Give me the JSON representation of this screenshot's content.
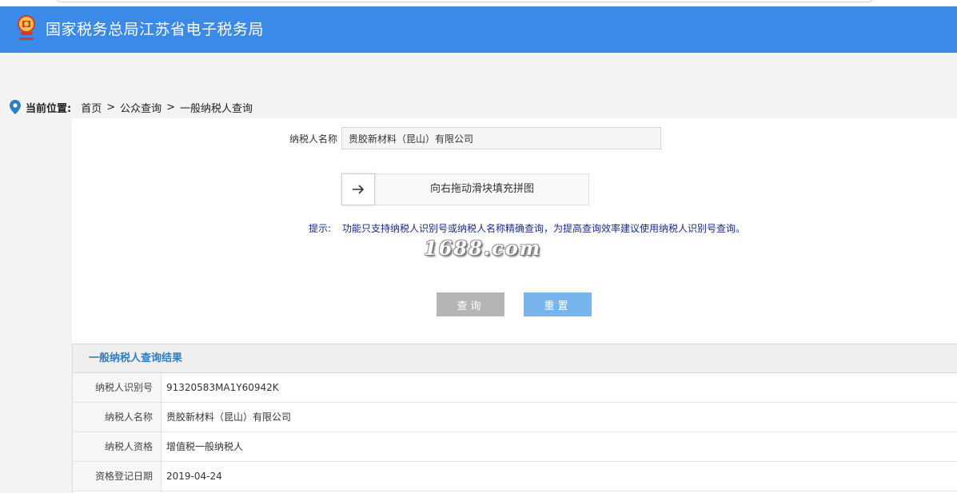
{
  "header": {
    "title": "国家税务总局江苏省电子税务局",
    "logo_icon": "tax-emblem-icon",
    "color": "#3c8ae8"
  },
  "breadcrumb": {
    "label": "当前位置:",
    "items": [
      "首页",
      "公众查询",
      "一般纳税人查询"
    ],
    "separator": ">"
  },
  "form": {
    "name_label": "纳税人名称",
    "name_value": "贵胶新材料（昆山）有限公司",
    "slider_text": "向右拖动滑块填充拼图",
    "slider_handle_icon": "arrow-right-icon",
    "hint_label": "提示:",
    "hint_text": "功能只支持纳税人识别号或纳税人名称精确查询，为提高查询效率建议使用纳税人识别号查询。",
    "query_button": "查询",
    "reset_button": "重置"
  },
  "watermark": "1688.com",
  "results": {
    "title": "一般纳税人查询结果",
    "rows": [
      {
        "key": "纳税人识别号",
        "value": "91320583MA1Y60942K"
      },
      {
        "key": "纳税人名称",
        "value": "贵胶新材料（昆山）有限公司"
      },
      {
        "key": "纳税人资格",
        "value": "增值税一般纳税人"
      },
      {
        "key": "资格登记日期",
        "value": "2019-04-24"
      }
    ]
  }
}
